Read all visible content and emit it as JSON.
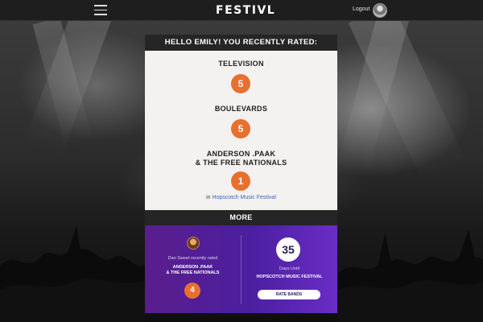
{
  "nav": {
    "brand": "FESTIVL",
    "logout_label": "Logout"
  },
  "card": {
    "header": "HELLO EMILY! YOU RECENTLY RATED:",
    "ratings": [
      {
        "band": "TELEVISION",
        "rating": "5"
      },
      {
        "band": "BOULEVARDS",
        "rating": "5"
      },
      {
        "band_line1": "ANDERSON .PAAK",
        "band_line2": "& THE FREE NATIONALS",
        "rating": "1"
      }
    ],
    "festival_prefix": "in",
    "festival_name": "Hopscotch Music Festival"
  },
  "more": {
    "label": "MORE",
    "friend": {
      "note": "Dan Sweet recently rated",
      "band_line1": "ANDERSON .PAAK",
      "band_line2": "& THE FREE NATIONALS",
      "rating": "4"
    },
    "countdown": {
      "days": "35",
      "label": "Days Until",
      "festival": "HOPSCOTCH MUSIC FESTIVAL",
      "button": "RATE BANDS"
    }
  },
  "colors": {
    "accent_orange": "#e86f2e",
    "promo_purple": "#4b1fa0",
    "link_blue": "#3a62c4",
    "bar_dark": "#252525"
  }
}
